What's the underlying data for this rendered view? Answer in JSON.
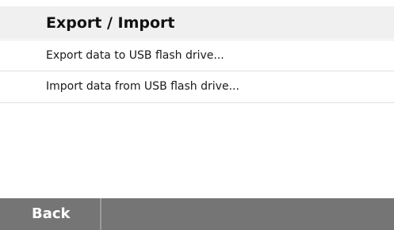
{
  "header": {
    "title": "Export / Import"
  },
  "menu": {
    "items": [
      {
        "label": "Export data to USB flash drive..."
      },
      {
        "label": "Import data from USB flash drive..."
      }
    ]
  },
  "footer": {
    "back_label": "Back"
  },
  "colors": {
    "header_bg": "#f0f0f0",
    "footer_bg": "#757575",
    "footer_text": "#ffffff"
  }
}
